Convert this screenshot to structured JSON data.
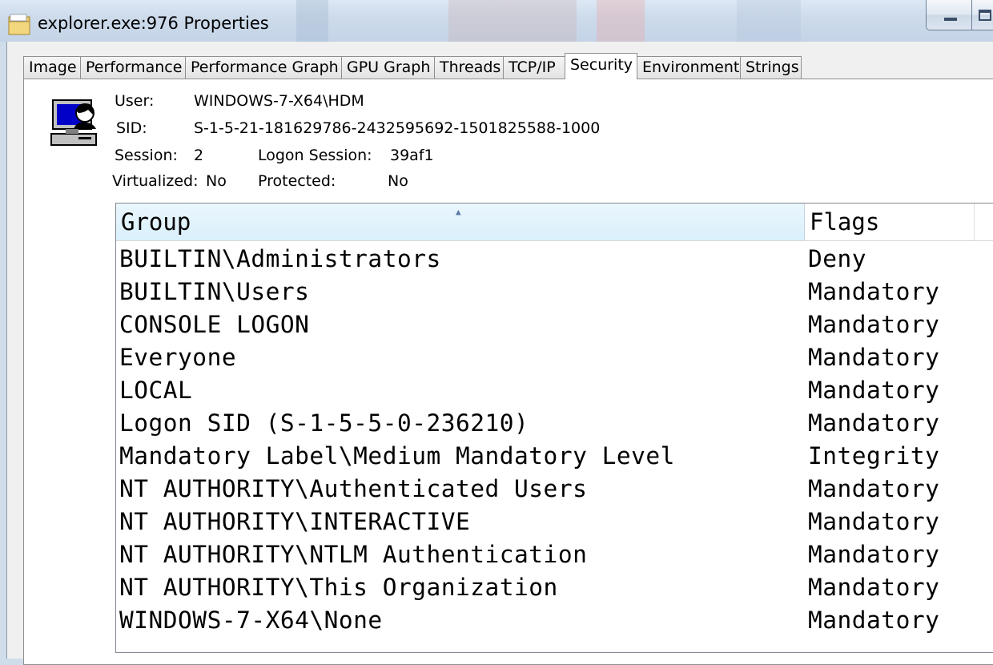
{
  "window": {
    "title": "explorer.exe:976 Properties",
    "icon": "folder-icon",
    "controls": {
      "minimize": "minimize-icon",
      "maximize": "maximize-icon"
    }
  },
  "tabs": [
    {
      "label": "Image"
    },
    {
      "label": "Performance"
    },
    {
      "label": "Performance Graph"
    },
    {
      "label": "GPU Graph"
    },
    {
      "label": "Threads"
    },
    {
      "label": "TCP/IP"
    },
    {
      "label": "Security",
      "active": true
    },
    {
      "label": "Environment"
    },
    {
      "label": "Strings"
    }
  ],
  "security": {
    "icon": "user-computer-icon",
    "user_label": "User:",
    "user_value": "WINDOWS-7-X64\\HDM",
    "sid_label": "SID:",
    "sid_value": "S-1-5-21-181629786-2432595692-1501825588-1000",
    "session_label": "Session:",
    "session_value": "2",
    "logon_session_label": "Logon Session:",
    "logon_session_value": "39af1",
    "virtualized_label": "Virtualized:",
    "virtualized_value": "No",
    "protected_label": "Protected:",
    "protected_value": "No"
  },
  "groups_table": {
    "columns": {
      "group": "Group",
      "flags": "Flags"
    },
    "sort_column": "group",
    "rows": [
      {
        "group": "BUILTIN\\Administrators",
        "flags": "Deny"
      },
      {
        "group": "BUILTIN\\Users",
        "flags": "Mandatory"
      },
      {
        "group": "CONSOLE LOGON",
        "flags": "Mandatory"
      },
      {
        "group": "Everyone",
        "flags": "Mandatory"
      },
      {
        "group": "LOCAL",
        "flags": "Mandatory"
      },
      {
        "group": "Logon SID (S-1-5-5-0-236210)",
        "flags": "Mandatory"
      },
      {
        "group": "Mandatory Label\\Medium Mandatory Level",
        "flags": "Integrity"
      },
      {
        "group": "NT AUTHORITY\\Authenticated Users",
        "flags": "Mandatory"
      },
      {
        "group": "NT AUTHORITY\\INTERACTIVE",
        "flags": "Mandatory"
      },
      {
        "group": "NT AUTHORITY\\NTLM Authentication",
        "flags": "Mandatory"
      },
      {
        "group": "NT AUTHORITY\\This Organization",
        "flags": "Mandatory"
      },
      {
        "group": "WINDOWS-7-X64\\None",
        "flags": "Mandatory"
      }
    ]
  }
}
